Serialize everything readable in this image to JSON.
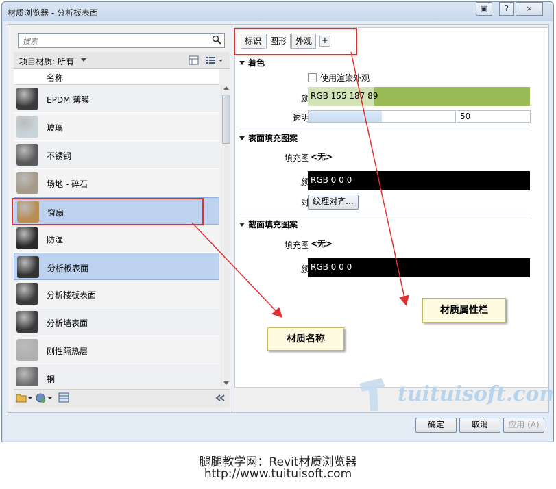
{
  "window": {
    "title": "材质浏览器 - 分析板表面"
  },
  "titlebar_buttons": [
    "?",
    "×"
  ],
  "search": {
    "placeholder": "搜索"
  },
  "filter": {
    "label": "项目材质: 所有"
  },
  "list": {
    "column_header": "名称",
    "items": [
      {
        "label": "EPDM 薄膜",
        "thumb": "#3a3a3a"
      },
      {
        "label": "玻璃",
        "thumb": "#c8d4d8"
      },
      {
        "label": "不锈钢",
        "thumb": "#5a5a5a"
      },
      {
        "label": "场地 - 碎石",
        "thumb": "#a69a88"
      },
      {
        "label": "窗扇",
        "thumb": "#b98c52"
      },
      {
        "label": "防湿",
        "thumb": "#2a2a2a"
      },
      {
        "label": "分析板表面",
        "thumb": "#333333"
      },
      {
        "label": "分析楼板表面",
        "thumb": "#3a3a3a"
      },
      {
        "label": "分析墙表面",
        "thumb": "#3a3a3a"
      },
      {
        "label": "刚性隔热层",
        "thumb": "#b0b0b0"
      },
      {
        "label": "钢",
        "thumb": "#6a6a6a"
      }
    ]
  },
  "tabs": [
    {
      "label": "标识"
    },
    {
      "label": "图形"
    },
    {
      "label": "外观"
    },
    {
      "label": "+"
    }
  ],
  "shading": {
    "title": "着色",
    "checkbox_label": "使用渲染外观",
    "color_label": "颜色",
    "color_value": "RGB 155 187 89",
    "color_hex": "#9bbb59",
    "transparency_label": "透明度",
    "transparency_value": "50",
    "transparency_fraction": 0.5
  },
  "surface_pattern": {
    "title": "表面填充图案",
    "pattern_label": "填充图案",
    "pattern_value": "<无>",
    "color_label": "颜色",
    "color_value": "RGB 0 0 0",
    "align_label": "对齐",
    "align_button": "纹理对齐..."
  },
  "cut_pattern": {
    "title": "截面填充图案",
    "pattern_label": "填充图案",
    "pattern_value": "<无>",
    "color_label": "颜色",
    "color_value": "RGB 0 0 0"
  },
  "footer": {
    "ok": "确定",
    "cancel": "取消",
    "apply": "应用 (A)"
  },
  "callouts": {
    "material_name": "材质名称",
    "material_properties": "材质属性栏"
  },
  "watermark": "tuituisoft.com",
  "caption": {
    "line1": "腿腿教学网：Revit材质浏览器",
    "line2": "http://www.tuituisoft.com"
  }
}
